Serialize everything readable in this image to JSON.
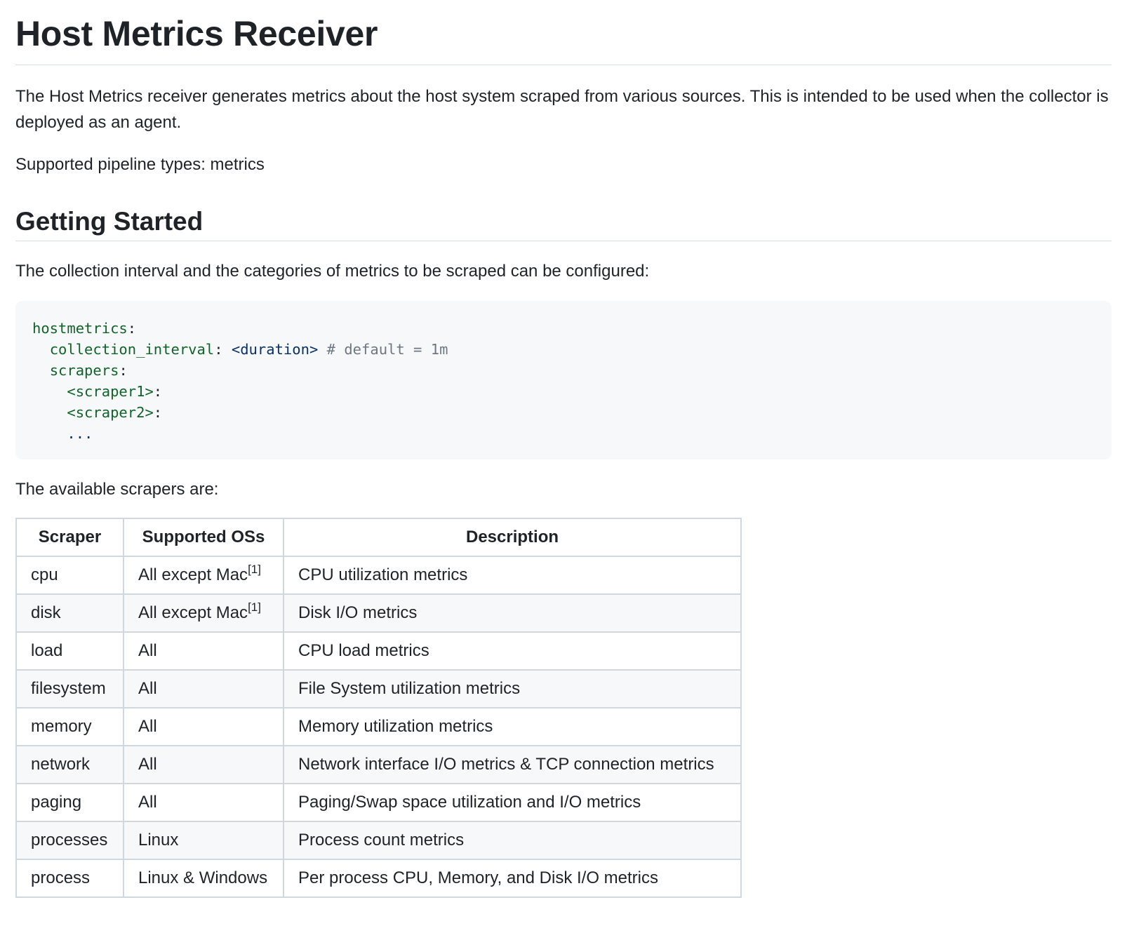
{
  "title": "Host Metrics Receiver",
  "intro": "The Host Metrics receiver generates metrics about the host system scraped from various sources. This is intended to be used when the collector is deployed as an agent.",
  "pipeline": "Supported pipeline types: metrics",
  "getting_started": {
    "heading": "Getting Started",
    "text": "The collection interval and the categories of metrics to be scraped can be configured:"
  },
  "code": {
    "l1_key": "hostmetrics",
    "colon": ":",
    "l2_key": "collection_interval",
    "l2_value": "<duration>",
    "l2_comment": "# default = 1m",
    "l3_key": "scrapers",
    "l4_key": "<scraper1>",
    "l5_key": "<scraper2>",
    "l6_ellipsis": "..."
  },
  "scrapers_text": "The available scrapers are:",
  "table": {
    "headers": [
      "Scraper",
      "Supported OSs",
      "Description"
    ],
    "footnote_mark": "[1]",
    "rows": [
      {
        "scraper": "cpu",
        "os": "All except Mac",
        "desc": "CPU utilization metrics"
      },
      {
        "scraper": "disk",
        "os": "All except Mac",
        "desc": "Disk I/O metrics"
      },
      {
        "scraper": "load",
        "os": "All",
        "desc": "CPU load metrics"
      },
      {
        "scraper": "filesystem",
        "os": "All",
        "desc": "File System utilization metrics"
      },
      {
        "scraper": "memory",
        "os": "All",
        "desc": "Memory utilization metrics"
      },
      {
        "scraper": "network",
        "os": "All",
        "desc": "Network interface I/O metrics & TCP connection metrics"
      },
      {
        "scraper": "paging",
        "os": "All",
        "desc": "Paging/Swap space utilization and I/O metrics"
      },
      {
        "scraper": "processes",
        "os": "Linux",
        "desc": "Process count metrics"
      },
      {
        "scraper": "process",
        "os": "Linux & Windows",
        "desc": "Per process CPU, Memory, and Disk I/O metrics"
      }
    ]
  }
}
